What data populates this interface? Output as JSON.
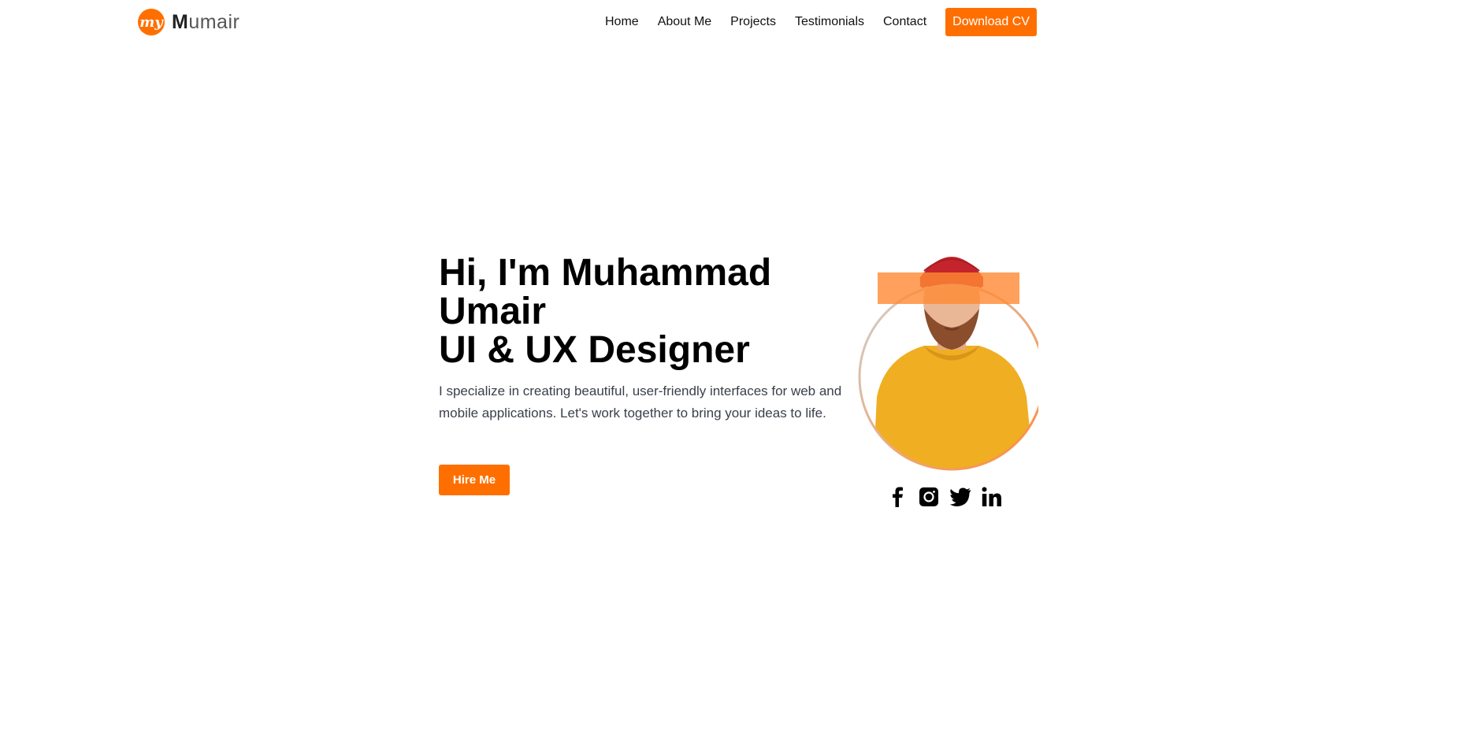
{
  "brand": {
    "logo_initials": "my",
    "name_bold": "M",
    "name_rest": "umair"
  },
  "nav": {
    "items": [
      "Home",
      "About Me",
      "Projects",
      "Testimonials",
      "Contact"
    ],
    "cta_label": "Download CV"
  },
  "hero": {
    "title_line1": "Hi, I'm Muhammad",
    "title_line2": "Umair",
    "title_line3": "UI & UX Designer",
    "description": "I specialize in creating beautiful, user-friendly interfaces for web and mobile applications. Let's work together to bring your ideas to life.",
    "cta_label": "Hire Me"
  },
  "socials": [
    "facebook-icon",
    "instagram-icon",
    "twitter-icon",
    "linkedin-icon"
  ],
  "colors": {
    "accent": "#ff6f00",
    "text": "#111111",
    "muted": "#3a3f4a"
  }
}
